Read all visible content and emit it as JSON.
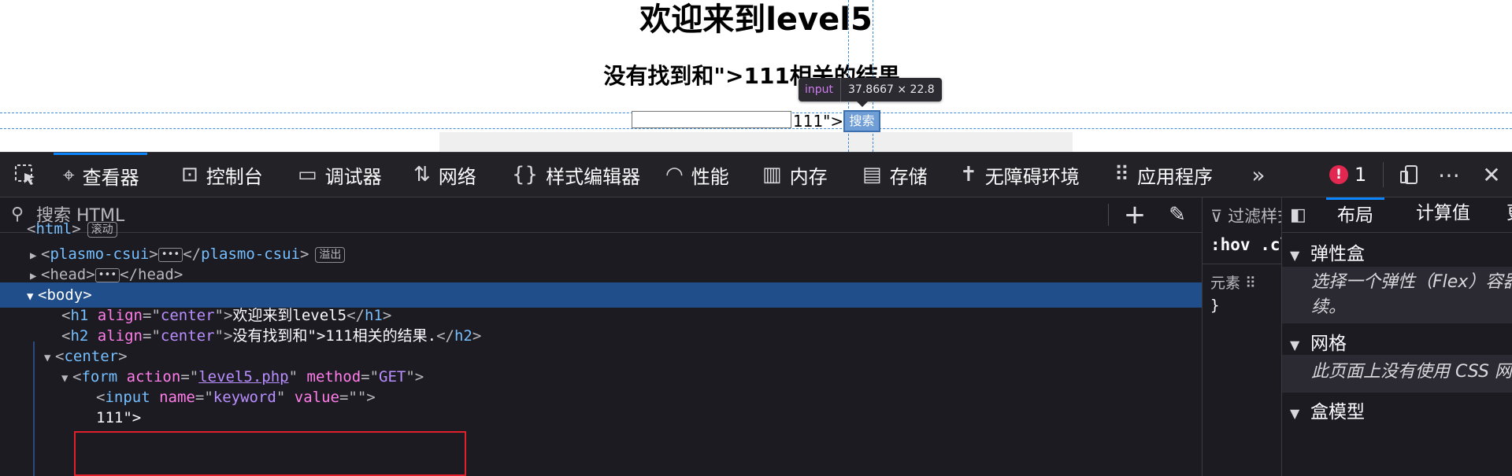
{
  "page": {
    "h1": "欢迎来到level5",
    "h2": "没有找到和\">111相关的结果.",
    "injected_text": "111\">",
    "submit_label": "搜索",
    "tooltip_tag": "input",
    "tooltip_dims": "37.8667 × 22.8"
  },
  "toolbar": {
    "pick_icon": "pick-element-icon",
    "tabs": [
      {
        "icon": "inspector-icon",
        "label": "查看器"
      },
      {
        "icon": "console-icon",
        "label": "控制台"
      },
      {
        "icon": "debugger-icon",
        "label": "调试器"
      },
      {
        "icon": "network-icon",
        "label": "网络"
      },
      {
        "icon": "style-editor-icon",
        "label": "样式编辑器"
      },
      {
        "icon": "performance-icon",
        "label": "性能"
      },
      {
        "icon": "memory-icon",
        "label": "内存"
      },
      {
        "icon": "storage-icon",
        "label": "存储"
      },
      {
        "icon": "accessibility-icon",
        "label": "无障碍环境"
      },
      {
        "icon": "application-icon",
        "label": "应用程序"
      }
    ],
    "error_count": "1"
  },
  "html_panel": {
    "search_placeholder": "搜索 HTML"
  },
  "tree": {
    "html_tag": "html",
    "html_badge": "滚动",
    "plasmo_tag": "plasmo-csui",
    "plasmo_badge": "溢出",
    "head_tag": "head",
    "body_tag": "body",
    "h1_tag": "h1",
    "h2_tag": "h2",
    "align_attr": "align",
    "align_val": "center",
    "h1_text": "欢迎来到level5",
    "h2_text": "没有找到和\">111相关的结果.",
    "center_tag": "center",
    "form_tag": "form",
    "action_attr": "action",
    "action_val": "level5.php",
    "method_attr": "method",
    "method_val": "GET",
    "input_tag": "input",
    "name_attr": "name",
    "name_val": "keyword",
    "value_attr": "value",
    "value_val": "",
    "text_node": "111\">"
  },
  "rules_panel": {
    "filter_label": "过滤样式",
    "hov": ":hov",
    "cls": ".cls",
    "element_label": "元素",
    "brace": "}"
  },
  "layout_panel": {
    "tabs": [
      "布局",
      "计算值",
      "更改"
    ],
    "flexbox_title": "弹性盒",
    "flexbox_desc": "选择一个弹性（Flex）容器或项目以继续。",
    "grid_title": "网格",
    "grid_desc": "此页面上没有使用 CSS 网格",
    "boxmodel_title": "盒模型"
  }
}
